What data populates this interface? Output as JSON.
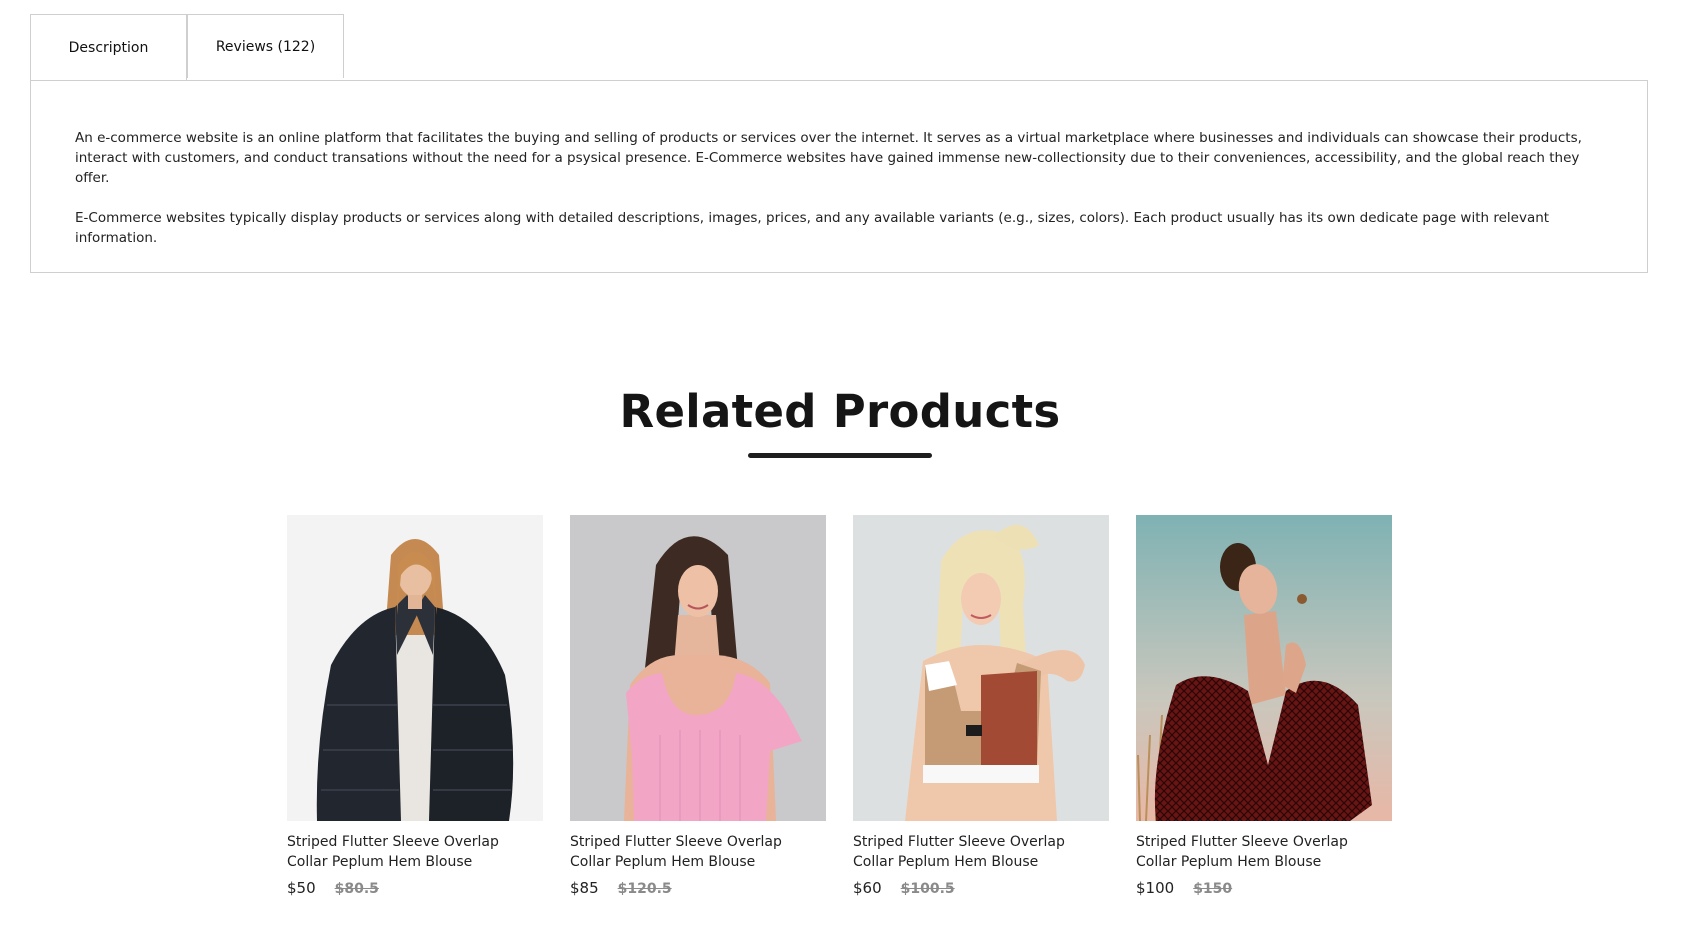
{
  "tabs": [
    {
      "label": "Description"
    },
    {
      "label": "Reviews (122)"
    }
  ],
  "description": {
    "paragraphs": [
      "An e-commerce website is an online platform that facilitates the buying and selling of products or services over the internet. It serves as a virtual marketplace where businesses and individuals can showcase their products, interact with customers, and conduct transations without the need for a psysical presence. E-Commerce websites have gained immense new-collectionsity due to their conveniences, accessibility, and the global reach they offer.",
      "E-Commerce websites typically display products or services along with detailed descriptions, images, prices, and any available variants (e.g., sizes, colors). Each product usually has its own dedicate page with relevant information."
    ]
  },
  "related": {
    "title": "Related Products",
    "products": [
      {
        "name": "Striped Flutter Sleeve Overlap Collar Peplum Hem Blouse",
        "price": "$50",
        "old_price": "$80.5",
        "image": "woman-black-fur-jacket"
      },
      {
        "name": "Striped Flutter Sleeve Overlap Collar Peplum Hem Blouse",
        "price": "$85",
        "old_price": "$120.5",
        "image": "woman-pink-top"
      },
      {
        "name": "Striped Flutter Sleeve Overlap Collar Peplum Hem Blouse",
        "price": "$60",
        "old_price": "$100.5",
        "image": "woman-sports-bra"
      },
      {
        "name": "Striped Flutter Sleeve Overlap Collar Peplum Hem Blouse",
        "price": "$100",
        "old_price": "$150",
        "image": "woman-red-patterned-blouse"
      }
    ]
  }
}
